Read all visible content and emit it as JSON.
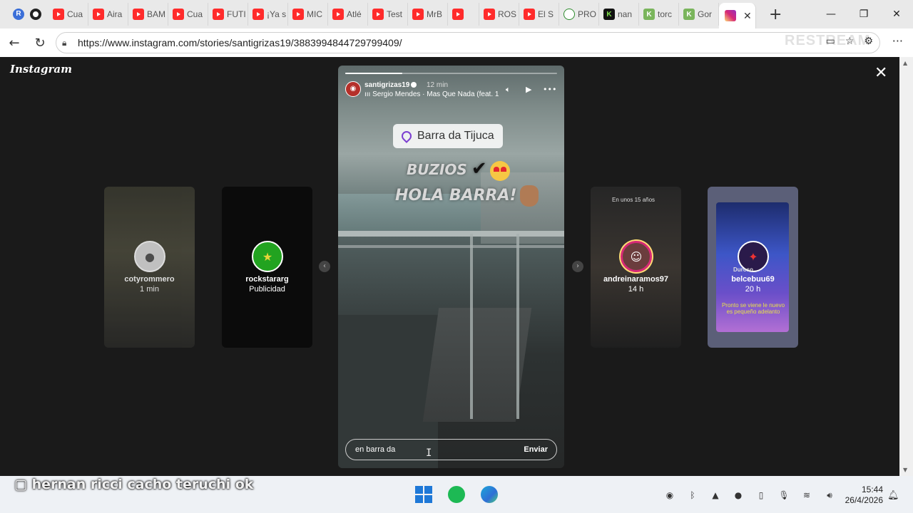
{
  "browser": {
    "tabs": [
      {
        "icon": "youtube-icon",
        "label": "Cua"
      },
      {
        "icon": "youtube-icon",
        "label": "Aira"
      },
      {
        "icon": "youtube-icon",
        "label": "BAM"
      },
      {
        "icon": "youtube-icon",
        "label": "Cua"
      },
      {
        "icon": "youtube-icon",
        "label": "FUTI"
      },
      {
        "icon": "youtube-icon",
        "label": "¡Ya s"
      },
      {
        "icon": "youtube-icon",
        "label": "MIC"
      },
      {
        "icon": "youtube-icon",
        "label": "Atlé"
      },
      {
        "icon": "youtube-icon",
        "label": "Test"
      },
      {
        "icon": "youtube-icon",
        "label": "MrB"
      },
      {
        "icon": "youtube-icon",
        "label": ""
      },
      {
        "icon": "youtube-icon",
        "label": "ROS"
      },
      {
        "icon": "youtube-icon",
        "label": "El S"
      },
      {
        "icon": "soccer-icon",
        "label": "PRO"
      },
      {
        "icon": "k-icon",
        "label": "nan"
      },
      {
        "icon": "k-icon",
        "label": "torc"
      },
      {
        "icon": "k-icon",
        "label": "Gor"
      }
    ],
    "active_tab_icon": "instagram-icon",
    "url": "https://www.instagram.com/stories/santigrizas19/3883994844729799409/",
    "restream_watermark": "RESTREAM"
  },
  "instagram": {
    "logo": "Instagram",
    "story": {
      "username": "santigrizas19",
      "time": "12 min",
      "song": "Sergio Mendes · Mas Que Nada (feat. 1",
      "progress_fraction": 0.27,
      "location_sticker": "Barra da Tijuca",
      "caption_line1": "BUZIOS",
      "caption_line2": "HOLA BARRA!",
      "reply_value": "en barra da",
      "send_label": "Enviar"
    },
    "side_stories": [
      {
        "name": "cotyrommero",
        "sub": "1 min"
      },
      {
        "name": "rockstararg",
        "sub": "Publicidad"
      },
      {
        "name": "andreinaramos97",
        "sub": "14 h",
        "overlay": "En unos 15 años"
      },
      {
        "name": "belcebuu69",
        "sub": "20 h",
        "overlay": "Duroso",
        "overlay2": "Pronto se viene le nuevo es pequeño adelanto"
      }
    ]
  },
  "stream_overlay": {
    "text": "hernan ricci cacho teruchi ok"
  },
  "taskbar": {
    "time": "15:44",
    "date": "26/4/2026"
  },
  "colors": {
    "accent": "#7c3fd1",
    "instagram_gradient_start": "#feda75",
    "instagram_gradient_end": "#962fbf"
  }
}
